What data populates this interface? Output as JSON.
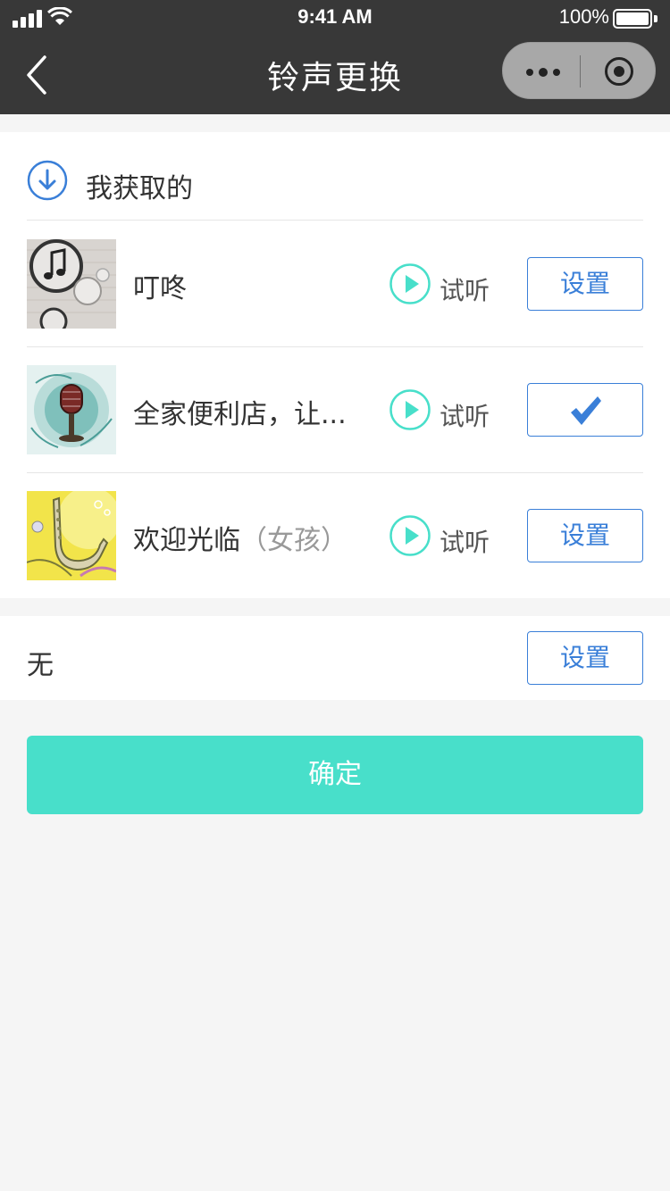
{
  "status_bar": {
    "time": "9:41 AM",
    "battery": "100%"
  },
  "nav": {
    "title": "铃声更换"
  },
  "section": {
    "title": "我获取的",
    "icon": "download-circle-icon"
  },
  "ringtones": [
    {
      "name": "叮咚",
      "name_suffix": "",
      "preview_label": "试听",
      "action_label": "设置",
      "selected": false,
      "thumb": "music-notes-thumb"
    },
    {
      "name": "全家便利店，让...",
      "name_suffix": "",
      "preview_label": "试听",
      "action_label": "",
      "selected": true,
      "thumb": "microphone-thumb"
    },
    {
      "name": "欢迎光临",
      "name_suffix": "（女孩）",
      "preview_label": "试听",
      "action_label": "设置",
      "selected": false,
      "thumb": "saxophone-thumb"
    }
  ],
  "none_option": {
    "label": "无",
    "action_label": "设置"
  },
  "confirm_label": "确定",
  "colors": {
    "accent_teal": "#48dfca",
    "accent_blue": "#3a7fd8",
    "nav_bg": "#383838"
  }
}
